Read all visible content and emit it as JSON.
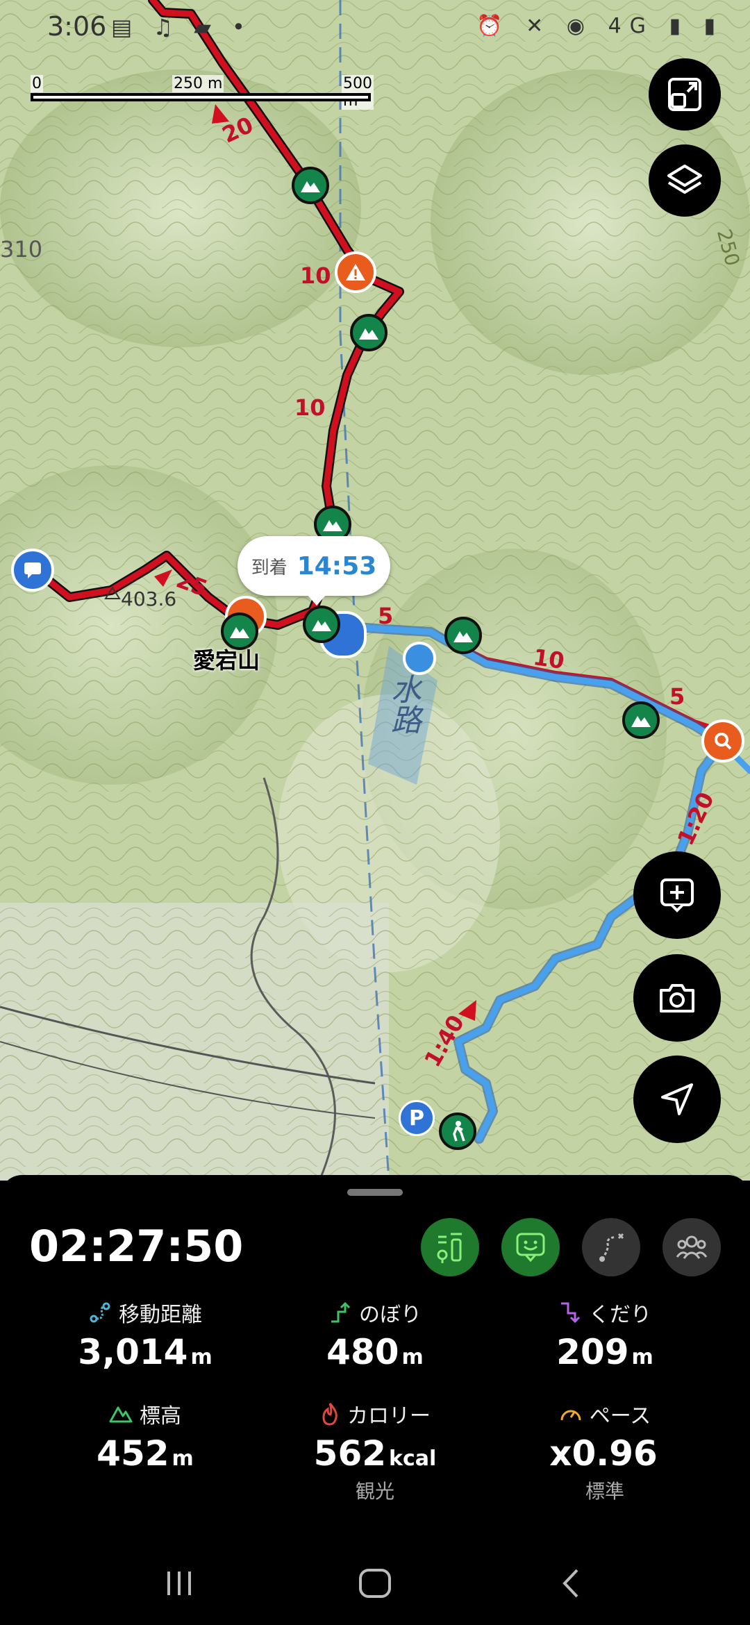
{
  "status_bar": {
    "time": "3:06",
    "network": "4G"
  },
  "map": {
    "scale": {
      "zero": "0",
      "mid": "250 m",
      "end": "500 m"
    },
    "contour_labels": [
      "310",
      "250"
    ],
    "spot_height": "403.6",
    "peak_name": "愛宕山",
    "route_numbers": {
      "n20": "20",
      "n10a": "10",
      "n10b": "10",
      "n25": "25",
      "n5a": "5",
      "n10c": "10",
      "n5b": "5",
      "t120": "1:20",
      "t140": "1:40"
    },
    "arrival": {
      "label": "到着",
      "time": "14:53"
    },
    "map_text": {
      "water": "水路"
    }
  },
  "sheet": {
    "elapsed": "02:27:50",
    "stats": [
      {
        "label": "移動距離",
        "value": "3,014",
        "unit": "m",
        "sub": ""
      },
      {
        "label": "のぼり",
        "value": "480",
        "unit": "m",
        "sub": ""
      },
      {
        "label": "くだり",
        "value": "209",
        "unit": "m",
        "sub": ""
      },
      {
        "label": "標高",
        "value": "452",
        "unit": "m",
        "sub": ""
      },
      {
        "label": "カロリー",
        "value": "562",
        "unit": "kcal",
        "sub": "観光"
      },
      {
        "label": "ペース",
        "value": "x0.96",
        "unit": "",
        "sub": "標準"
      }
    ]
  },
  "colors": {
    "route_red": "#d0101e",
    "route_blue": "#3a8fe0",
    "poi_green": "#14854a",
    "active_mode": "#1f7a2e"
  }
}
